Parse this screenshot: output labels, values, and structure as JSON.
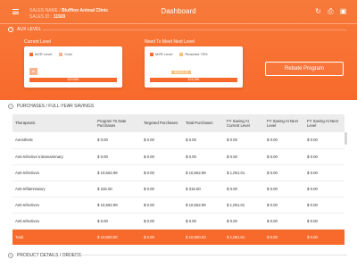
{
  "header": {
    "clinic_key": "SALES NAME /",
    "clinic_name": "Bluffton Animal Clinic",
    "id_key": "SALES ID :",
    "id_value": "11920",
    "title": "Dashboard",
    "icons": [
      "menu-icon",
      "refresh-icon",
      "print-icon",
      "window-icon"
    ]
  },
  "aux_level": {
    "section_title": "AUX LEVEL",
    "current": {
      "label": "Current Level",
      "legend_mzr": "MZR Level",
      "legend_cost": "Cost",
      "small_bar_value": "$0",
      "full_bar_value": "$29,596"
    },
    "next": {
      "label": "Need To Meet Next Level",
      "legend_mzr": "MZR Level",
      "legend_reached": "Reached 75%",
      "yellow_bar_value": "$5,500.00",
      "full_bar_value": "$24,096"
    },
    "rebate_button": "Rebate Program"
  },
  "purchases": {
    "section_title": "PURCHASES / FULL-YEAR SAVINGS",
    "columns": [
      "Therapeutic",
      "Program To Date Purchases",
      "Targeted Purchases",
      "Total Purchases",
      "FY Saving At Current Level",
      "FY Saving At Next Level",
      "FY Saving At Next Level"
    ],
    "rows": [
      {
        "therapeutic": "Anesthetic",
        "ptd": "$ 0.00",
        "targeted": "$ 0.00",
        "total": "$ 0.00",
        "fy_cur": "$ 0.00",
        "fy_next": "$ 0.00",
        "fy_next2": "$ 0.00"
      },
      {
        "therapeutic": "Anti-Infective Intramammary",
        "ptd": "$ 0.00",
        "targeted": "$ 0.00",
        "total": "$ 0.00",
        "fy_cur": "$ 0.00",
        "fy_next": "$ 0.00",
        "fy_next2": "$ 0.00"
      },
      {
        "therapeutic": "Anti-Infectives",
        "ptd": "$ 10,562.99",
        "targeted": "$ 0.00",
        "total": "$ 10,562.99",
        "fy_cur": "$ 1,051.01",
        "fy_next": "$ 0.00",
        "fy_next2": "$ 0.00"
      },
      {
        "therapeutic": "Anti-Inflammatory",
        "ptd": "$ 315.00",
        "targeted": "$ 0.00",
        "total": "$ 315.00",
        "fy_cur": "$ 0.00",
        "fy_next": "$ 0.00",
        "fy_next2": "$ 0.00"
      },
      {
        "therapeutic": "Anti-Infectives",
        "ptd": "$ 10,562.99",
        "targeted": "$ 0.00",
        "total": "$ 10,562.99",
        "fy_cur": "$ 1,051.01",
        "fy_next": "$ 0.00",
        "fy_next2": "$ 0.00"
      },
      {
        "therapeutic": "Anti-Infectives",
        "ptd": "$ 0.00",
        "targeted": "$ 0.00",
        "total": "$ 0.00",
        "fy_cur": "$ 0.00",
        "fy_next": "$ 0.00",
        "fy_next2": "$ 0.00"
      }
    ],
    "total_row": {
      "therapeutic": "Total",
      "ptd": "$ 10,800.00",
      "targeted": "$ 0.00",
      "total": "$ 10,800.03",
      "fy_cur": "$ 1,051.01",
      "fy_next": "$ 0.00",
      "fy_next2": "$ 0.00"
    }
  },
  "product_details": {
    "section_title": "PRODUCT DETAILS / ORDERS"
  },
  "colors": {
    "accent": "#f86a2c",
    "accent_light": "#f9b38e",
    "reached_yellow": "#f7c07a"
  }
}
